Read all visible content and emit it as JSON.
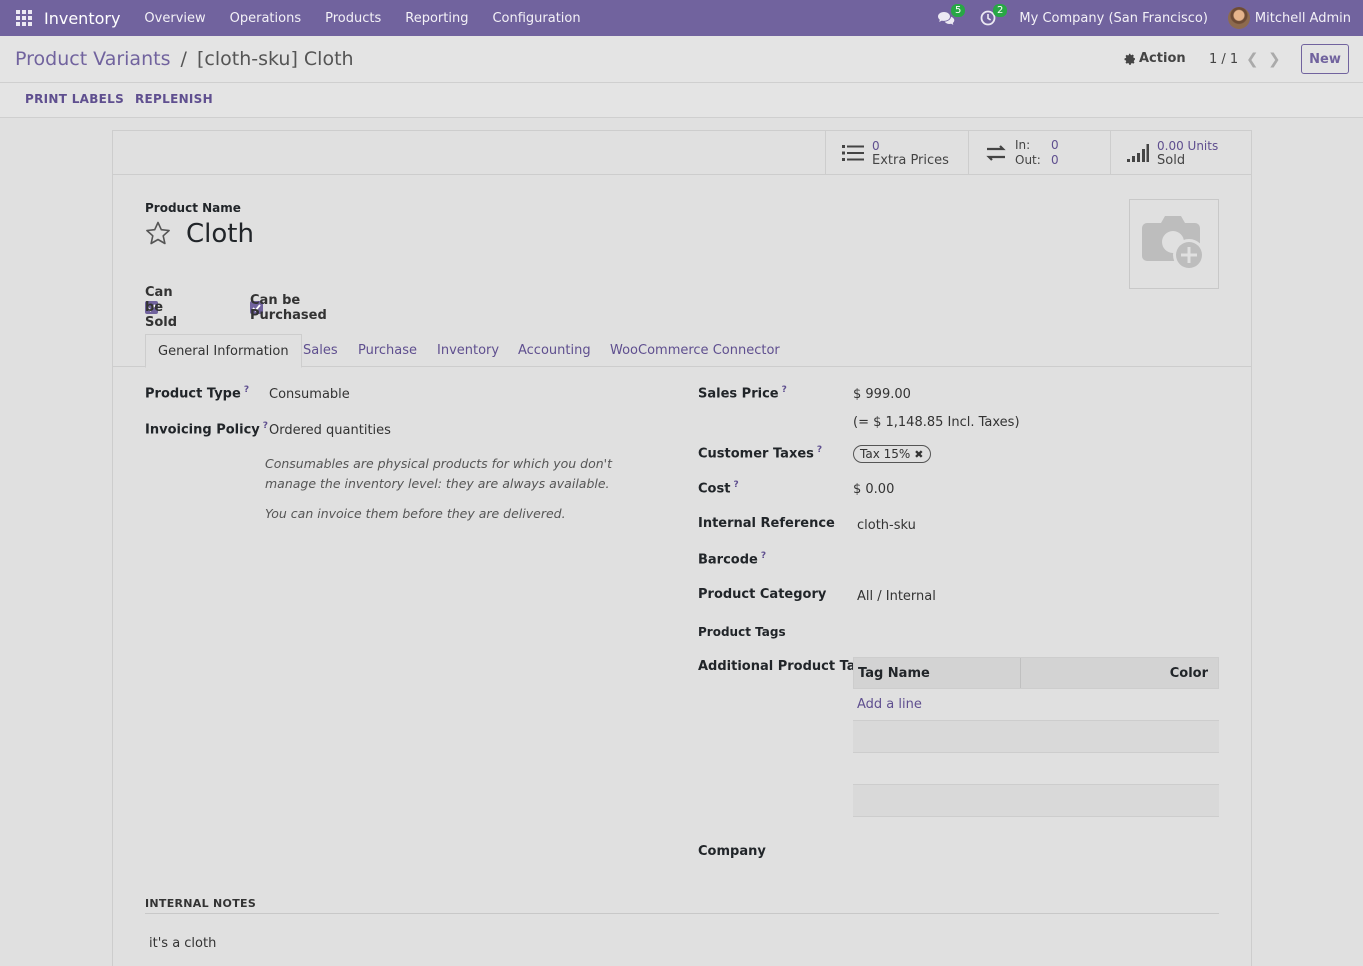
{
  "navbar": {
    "app_title": "Inventory",
    "menu": [
      "Overview",
      "Operations",
      "Products",
      "Reporting",
      "Configuration"
    ],
    "chat_count": "5",
    "activity_count": "2",
    "company": "My Company (San Francisco)",
    "user": "Mitchell Admin"
  },
  "control_panel": {
    "breadcrumb_parent": "Product Variants",
    "breadcrumb_sep": "/",
    "breadcrumb_current": "[cloth-sku] Cloth",
    "action_label": "Action",
    "pager": "1 / 1",
    "new_label": "New"
  },
  "buttons": {
    "print_labels": "PRINT LABELS",
    "replenish": "REPLENISH"
  },
  "smart_buttons": {
    "extra_prices_value": "0",
    "extra_prices_label": "Extra Prices",
    "in_label": "In:",
    "in_value": "0",
    "out_label": "Out:",
    "out_value": "0",
    "sold_value": "0.00 Units",
    "sold_label": "Sold"
  },
  "product": {
    "name_label": "Product Name",
    "name": "Cloth",
    "can_be_sold": "Can be Sold",
    "can_be_purchased": "Can be Purchased"
  },
  "tabs": [
    "General Information",
    "Sales",
    "Purchase",
    "Inventory",
    "Accounting",
    "WooCommerce Connector"
  ],
  "general": {
    "product_type_label": "Product Type",
    "product_type": "Consumable",
    "invoicing_policy_label": "Invoicing Policy",
    "invoicing_policy": "Ordered quantities",
    "note1": "Consumables are physical products for which you don't manage the inventory level: they are always available.",
    "note2": "You can invoice them before they are delivered.",
    "sales_price_label": "Sales Price",
    "sales_price": "$ 999.00",
    "incl_taxes": "(= $ 1,148.85 Incl. Taxes)",
    "customer_taxes_label": "Customer Taxes",
    "customer_tax": "Tax 15%",
    "cost_label": "Cost",
    "cost": "$ 0.00",
    "internal_ref_label": "Internal Reference",
    "internal_ref": "cloth-sku",
    "barcode_label": "Barcode",
    "category_label": "Product Category",
    "category": "All / Internal",
    "tags_label": "Product Tags",
    "additional_tag_label": "Additional Product Tag",
    "tag_col_name": "Tag Name",
    "tag_col_color": "Color",
    "add_line": "Add a line",
    "company_label": "Company",
    "help_mark": "?"
  },
  "notes": {
    "heading": "INTERNAL NOTES",
    "body": "it's a cloth"
  },
  "colors": {
    "brand": "#71639e",
    "link": "#5f4f8f",
    "badge": "#28a745"
  }
}
